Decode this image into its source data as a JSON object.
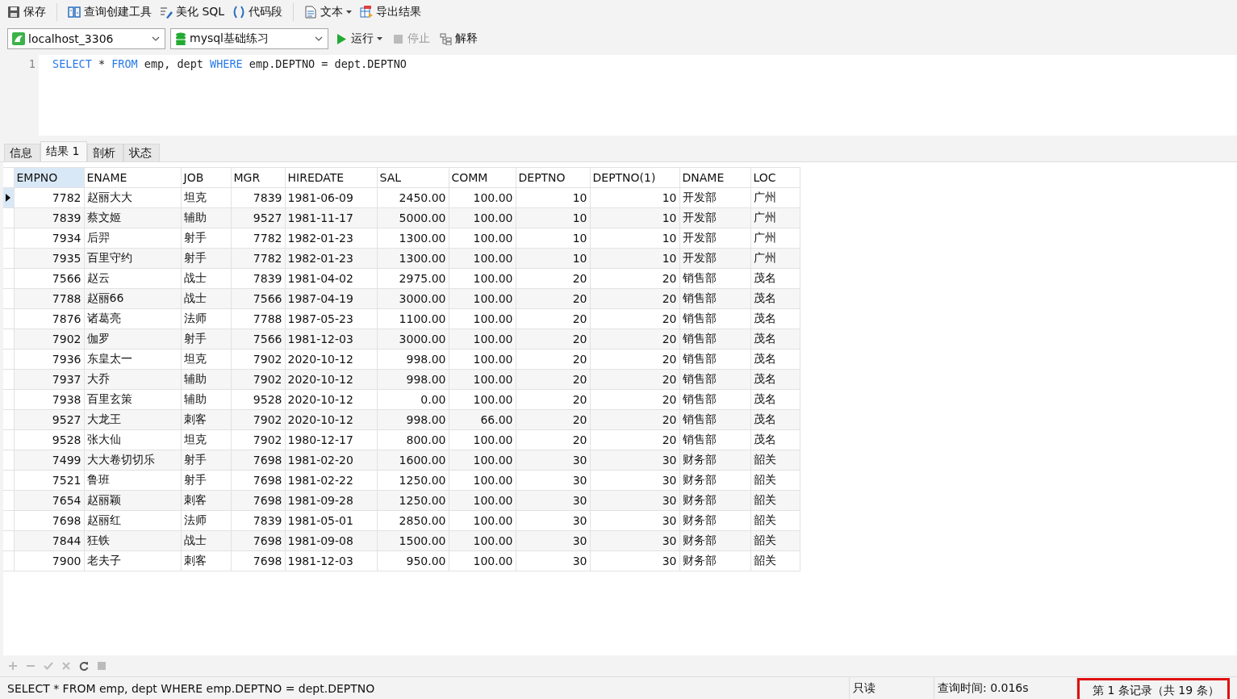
{
  "toolbar": [
    {
      "kind": "save",
      "label": "保存",
      "group_start": false,
      "dropdown": false
    },
    {
      "kind": "builder",
      "label": "查询创建工具",
      "group_start": true,
      "dropdown": false
    },
    {
      "kind": "beautify",
      "label": "美化 SQL",
      "group_start": false,
      "dropdown": false
    },
    {
      "kind": "snippet",
      "label": "代码段",
      "group_start": false,
      "dropdown": false
    },
    {
      "kind": "text",
      "label": "文本",
      "dropdown": true,
      "group_start": true
    },
    {
      "kind": "export",
      "label": "导出结果",
      "group_start": false,
      "dropdown": false
    }
  ],
  "connection": {
    "value": "localhost_3306"
  },
  "database": {
    "value": "mysql基础练习"
  },
  "actions": [
    {
      "kind": "run",
      "label": "运行",
      "dropdown": true,
      "disabled": false
    },
    {
      "kind": "stop",
      "label": "停止",
      "dropdown": false,
      "disabled": true
    },
    {
      "kind": "explain",
      "label": "解释",
      "dropdown": false,
      "disabled": false
    }
  ],
  "editor": {
    "lines": [
      {
        "number": "1",
        "tokens": [
          {
            "kind": "keyword",
            "text": "SELECT"
          },
          {
            "kind": "plain",
            "text": " * "
          },
          {
            "kind": "keyword",
            "text": "FROM"
          },
          {
            "kind": "plain",
            "text": " emp, dept "
          },
          {
            "kind": "keyword",
            "text": "WHERE"
          },
          {
            "kind": "plain",
            "text": " emp.DEPTNO = dept.DEPTNO"
          }
        ]
      }
    ]
  },
  "result_tabs": [
    {
      "label": "信息",
      "selected": false
    },
    {
      "label": "结果 1",
      "selected": true
    },
    {
      "label": "剖析",
      "selected": false
    },
    {
      "label": "状态",
      "selected": false
    }
  ],
  "table": {
    "columns": [
      {
        "label": "EMPNO",
        "kind": "number",
        "selected": true
      },
      {
        "label": "ENAME",
        "kind": "text",
        "selected": false
      },
      {
        "label": "JOB",
        "kind": "text",
        "selected": false
      },
      {
        "label": "MGR",
        "kind": "number",
        "selected": false
      },
      {
        "label": "HIREDATE",
        "kind": "text",
        "selected": false
      },
      {
        "label": "SAL",
        "kind": "number",
        "selected": false
      },
      {
        "label": "COMM",
        "kind": "number",
        "selected": false
      },
      {
        "label": "DEPTNO",
        "kind": "number",
        "selected": false
      },
      {
        "label": "DEPTNO(1)",
        "kind": "number",
        "selected": false
      },
      {
        "label": "DNAME",
        "kind": "text",
        "selected": false
      },
      {
        "label": "LOC",
        "kind": "text",
        "selected": false
      }
    ],
    "rows": [
      {
        "selected": true,
        "cells": [
          "7782",
          "赵丽大大",
          "坦克",
          "7839",
          "1981-06-09",
          "2450.00",
          "100.00",
          "10",
          "10",
          "开发部",
          "广州"
        ]
      },
      {
        "selected": false,
        "cells": [
          "7839",
          "蔡文姬",
          "辅助",
          "9527",
          "1981-11-17",
          "5000.00",
          "100.00",
          "10",
          "10",
          "开发部",
          "广州"
        ]
      },
      {
        "selected": false,
        "cells": [
          "7934",
          "后羿",
          "射手",
          "7782",
          "1982-01-23",
          "1300.00",
          "100.00",
          "10",
          "10",
          "开发部",
          "广州"
        ]
      },
      {
        "selected": false,
        "cells": [
          "7935",
          "百里守约",
          "射手",
          "7782",
          "1982-01-23",
          "1300.00",
          "100.00",
          "10",
          "10",
          "开发部",
          "广州"
        ]
      },
      {
        "selected": false,
        "cells": [
          "7566",
          "赵云",
          "战士",
          "7839",
          "1981-04-02",
          "2975.00",
          "100.00",
          "20",
          "20",
          "销售部",
          "茂名"
        ]
      },
      {
        "selected": false,
        "cells": [
          "7788",
          "赵丽66",
          "战士",
          "7566",
          "1987-04-19",
          "3000.00",
          "100.00",
          "20",
          "20",
          "销售部",
          "茂名"
        ]
      },
      {
        "selected": false,
        "cells": [
          "7876",
          "诸葛亮",
          "法师",
          "7788",
          "1987-05-23",
          "1100.00",
          "100.00",
          "20",
          "20",
          "销售部",
          "茂名"
        ]
      },
      {
        "selected": false,
        "cells": [
          "7902",
          "伽罗",
          "射手",
          "7566",
          "1981-12-03",
          "3000.00",
          "100.00",
          "20",
          "20",
          "销售部",
          "茂名"
        ]
      },
      {
        "selected": false,
        "cells": [
          "7936",
          "东皇太一",
          "坦克",
          "7902",
          "2020-10-12",
          "998.00",
          "100.00",
          "20",
          "20",
          "销售部",
          "茂名"
        ]
      },
      {
        "selected": false,
        "cells": [
          "7937",
          "大乔",
          "辅助",
          "7902",
          "2020-10-12",
          "998.00",
          "100.00",
          "20",
          "20",
          "销售部",
          "茂名"
        ]
      },
      {
        "selected": false,
        "cells": [
          "7938",
          "百里玄策",
          "辅助",
          "9528",
          "2020-10-12",
          "0.00",
          "100.00",
          "20",
          "20",
          "销售部",
          "茂名"
        ]
      },
      {
        "selected": false,
        "cells": [
          "9527",
          "大龙王",
          "刺客",
          "7902",
          "2020-10-12",
          "998.00",
          "66.00",
          "20",
          "20",
          "销售部",
          "茂名"
        ]
      },
      {
        "selected": false,
        "cells": [
          "9528",
          "张大仙",
          "坦克",
          "7902",
          "1980-12-17",
          "800.00",
          "100.00",
          "20",
          "20",
          "销售部",
          "茂名"
        ]
      },
      {
        "selected": false,
        "cells": [
          "7499",
          "大大卷切切乐",
          "射手",
          "7698",
          "1981-02-20",
          "1600.00",
          "100.00",
          "30",
          "30",
          "财务部",
          "韶关"
        ]
      },
      {
        "selected": false,
        "cells": [
          "7521",
          "鲁班",
          "射手",
          "7698",
          "1981-02-22",
          "1250.00",
          "100.00",
          "30",
          "30",
          "财务部",
          "韶关"
        ]
      },
      {
        "selected": false,
        "cells": [
          "7654",
          "赵丽颖",
          "刺客",
          "7698",
          "1981-09-28",
          "1250.00",
          "100.00",
          "30",
          "30",
          "财务部",
          "韶关"
        ]
      },
      {
        "selected": false,
        "cells": [
          "7698",
          "赵丽红",
          "法师",
          "7839",
          "1981-05-01",
          "2850.00",
          "100.00",
          "30",
          "30",
          "财务部",
          "韶关"
        ]
      },
      {
        "selected": false,
        "cells": [
          "7844",
          "狂铁",
          "战士",
          "7698",
          "1981-09-08",
          "1500.00",
          "100.00",
          "30",
          "30",
          "财务部",
          "韶关"
        ]
      },
      {
        "selected": false,
        "cells": [
          "7900",
          "老夫子",
          "刺客",
          "7698",
          "1981-12-03",
          "950.00",
          "100.00",
          "30",
          "30",
          "财务部",
          "韶关"
        ]
      }
    ]
  },
  "grid_toolbar": [
    {
      "kind": "add",
      "disabled": true
    },
    {
      "kind": "remove",
      "disabled": true
    },
    {
      "kind": "apply",
      "disabled": true
    },
    {
      "kind": "discard",
      "disabled": true
    },
    {
      "kind": "refresh",
      "disabled": false
    },
    {
      "kind": "stop",
      "disabled": true
    }
  ],
  "status_bar": {
    "query": "SELECT * FROM emp, dept WHERE emp.DEPTNO = dept.DEPTNO",
    "mode": "只读",
    "time": "查询时间: 0.016s",
    "record": {
      "text": "第 1 条记录（共 19 条）",
      "highlighted": true
    }
  }
}
